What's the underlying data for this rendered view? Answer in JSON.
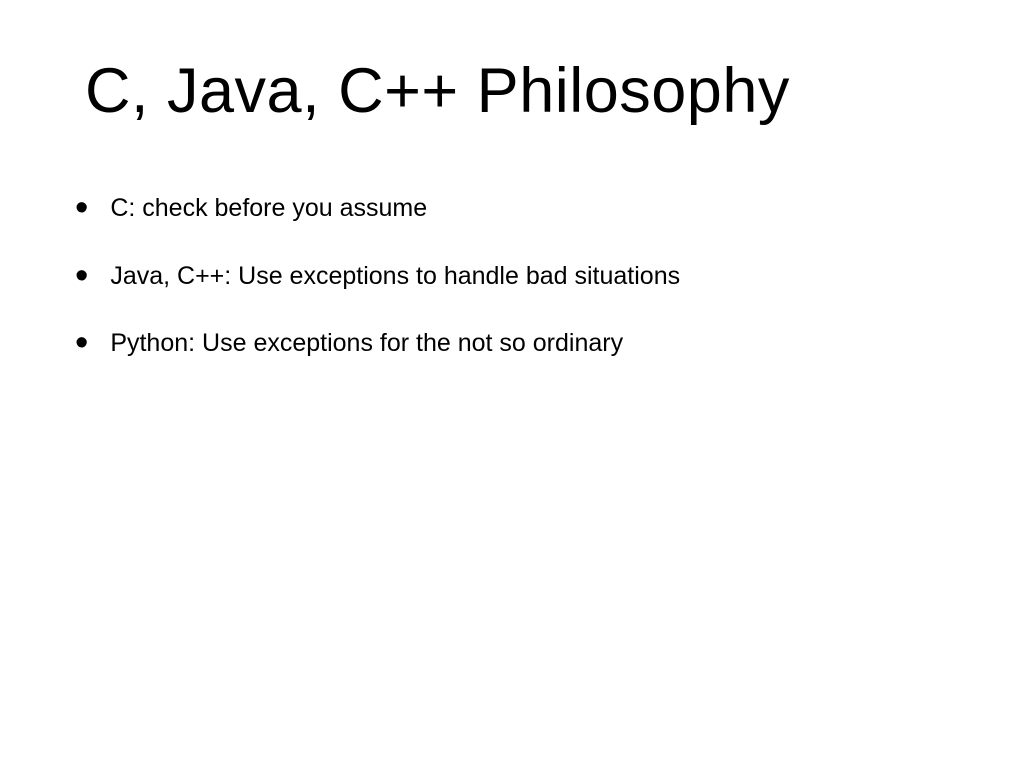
{
  "slide": {
    "title": "C, Java, C++ Philosophy",
    "bullets": [
      "C: check before you assume",
      "Java, C++: Use exceptions to handle bad situations",
      "Python: Use exceptions for the not so ordinary"
    ]
  }
}
